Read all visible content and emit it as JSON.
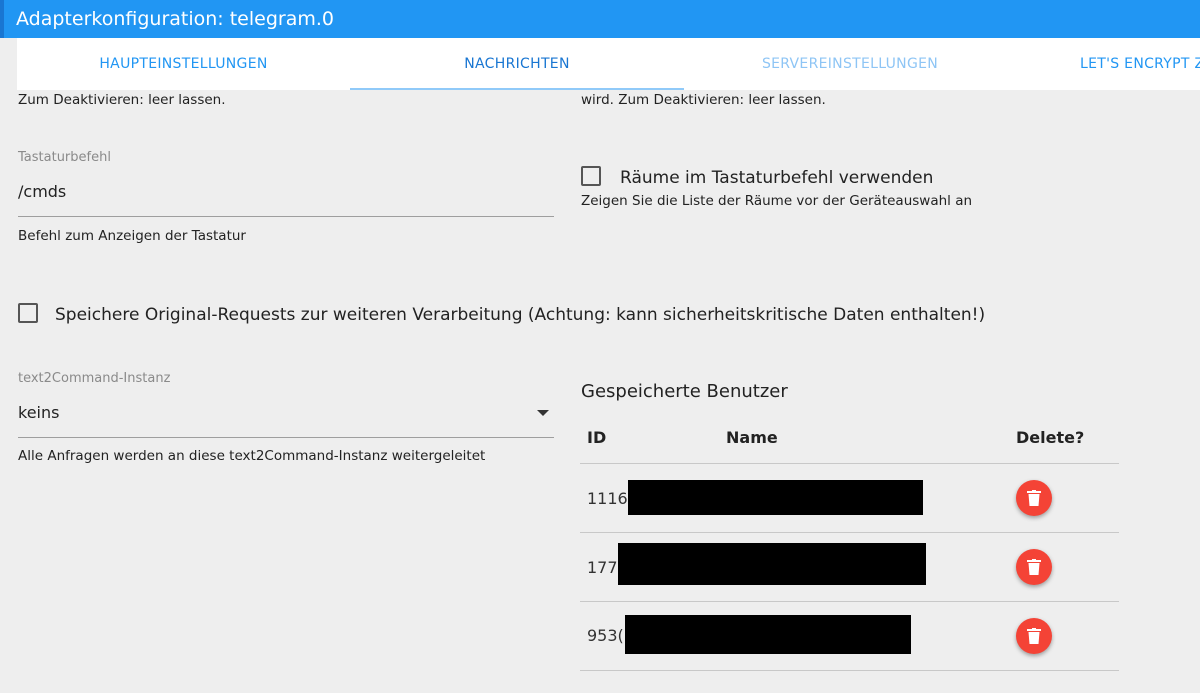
{
  "window": {
    "title": "Adapterkonfiguration: telegram.0"
  },
  "tabs": [
    {
      "label": "HAUPTEINSTELLUNGEN"
    },
    {
      "label": "NACHRICHTEN"
    },
    {
      "label": "SERVEREINSTELLUNGEN"
    },
    {
      "label": "LET'S ENCRYPT Z"
    }
  ],
  "top_left_hint": "Zum Deaktivieren: leer lassen.",
  "top_right_hint": "wird. Zum Deaktivieren: leer lassen.",
  "keyboard_command": {
    "label": "Tastaturbefehl",
    "value": "/cmds",
    "help": "Befehl zum Anzeigen der Tastatur"
  },
  "rooms_option": {
    "label": "Räume im Tastaturbefehl verwenden",
    "help": "Zeigen Sie die Liste der Räume vor der Geräteauswahl an",
    "checked": false
  },
  "store_requests": {
    "label": "Speichere Original-Requests zur weiteren Verarbeitung (Achtung: kann sicherheitskritische Daten enthalten!)",
    "checked": false
  },
  "text2command": {
    "label": "text2Command-Instanz",
    "value": "keins",
    "help": "Alle Anfragen werden an diese text2Command-Instanz weitergeleitet"
  },
  "saved_users": {
    "title": "Gespeicherte Benutzer",
    "columns": {
      "id": "ID",
      "name": "Name",
      "delete": "Delete?"
    },
    "rows": [
      {
        "id": "1116"
      },
      {
        "id": "177"
      },
      {
        "id": "953("
      }
    ]
  },
  "colors": {
    "accent": "#2196f3",
    "delete": "#f44336",
    "background": "#eeeeee"
  },
  "icons": {
    "delete": "trash-icon",
    "dropdown": "caret-down-icon",
    "checkbox": "checkbox-unchecked-icon"
  }
}
